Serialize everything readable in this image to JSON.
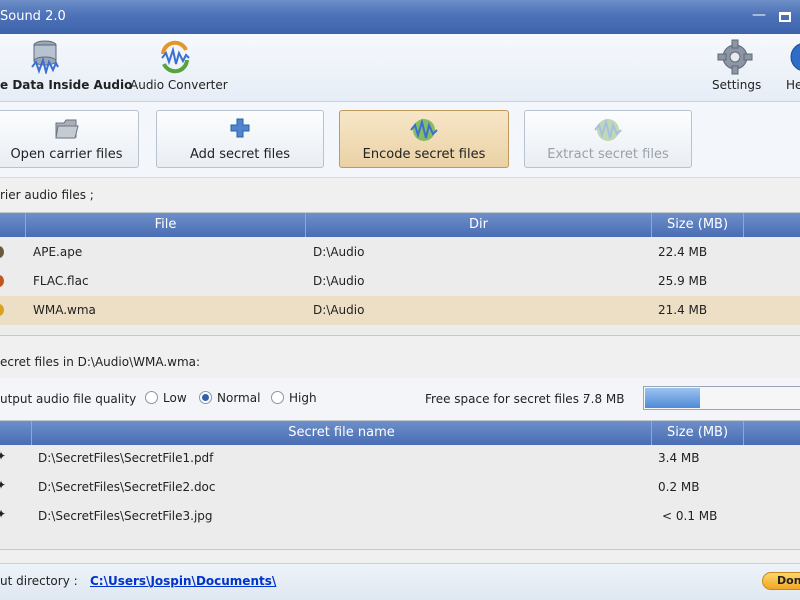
{
  "window": {
    "title": "Sound 2.0"
  },
  "toolbar": {
    "hide_label": "e Data Inside Audio",
    "converter_label": "Audio Converter",
    "settings_label": "Settings",
    "help_label": "He"
  },
  "actions": {
    "open_label": "Open carrier files",
    "add_label": "Add secret files",
    "encode_label": "Encode secret files",
    "extract_label": "Extract secret files"
  },
  "carrier": {
    "section_label": "rier audio files ;",
    "columns": [
      "File",
      "Dir",
      "Size (MB)"
    ],
    "rows": [
      {
        "file": "APE.ape",
        "dir": "D:\\Audio",
        "size": "22.4 MB",
        "selected": false
      },
      {
        "file": "FLAC.flac",
        "dir": "D:\\Audio",
        "size": "25.9 MB",
        "selected": false
      },
      {
        "file": "WMA.wma",
        "dir": "D:\\Audio",
        "size": "21.4 MB",
        "selected": true
      }
    ]
  },
  "secret": {
    "section_label": "ecret files in D:\\Audio\\WMA.wma:",
    "quality_label": "utput audio file quality",
    "quality_options": [
      "Low",
      "Normal",
      "High"
    ],
    "quality_selected": "Normal",
    "free_space_label": "Free space for secret files :",
    "free_space_value": "7.8 MB",
    "free_space_fill": 0.35,
    "columns": [
      "Secret file name",
      "Size (MB)"
    ],
    "rows": [
      {
        "name": "D:\\SecretFiles\\SecretFile1.pdf",
        "size": "3.4 MB"
      },
      {
        "name": "D:\\SecretFiles\\SecretFile2.doc",
        "size": "0.2 MB"
      },
      {
        "name": "D:\\SecretFiles\\SecretFile3.jpg",
        "size": "< 0.1 MB"
      }
    ]
  },
  "output": {
    "label": "ut directory :",
    "path": "C:\\Users\\Jospin\\Documents\\",
    "donate_label": "Dona"
  },
  "colors": {
    "header": "#4a6db4",
    "selected_row": "#ecdfc6",
    "link": "#0033cc"
  }
}
